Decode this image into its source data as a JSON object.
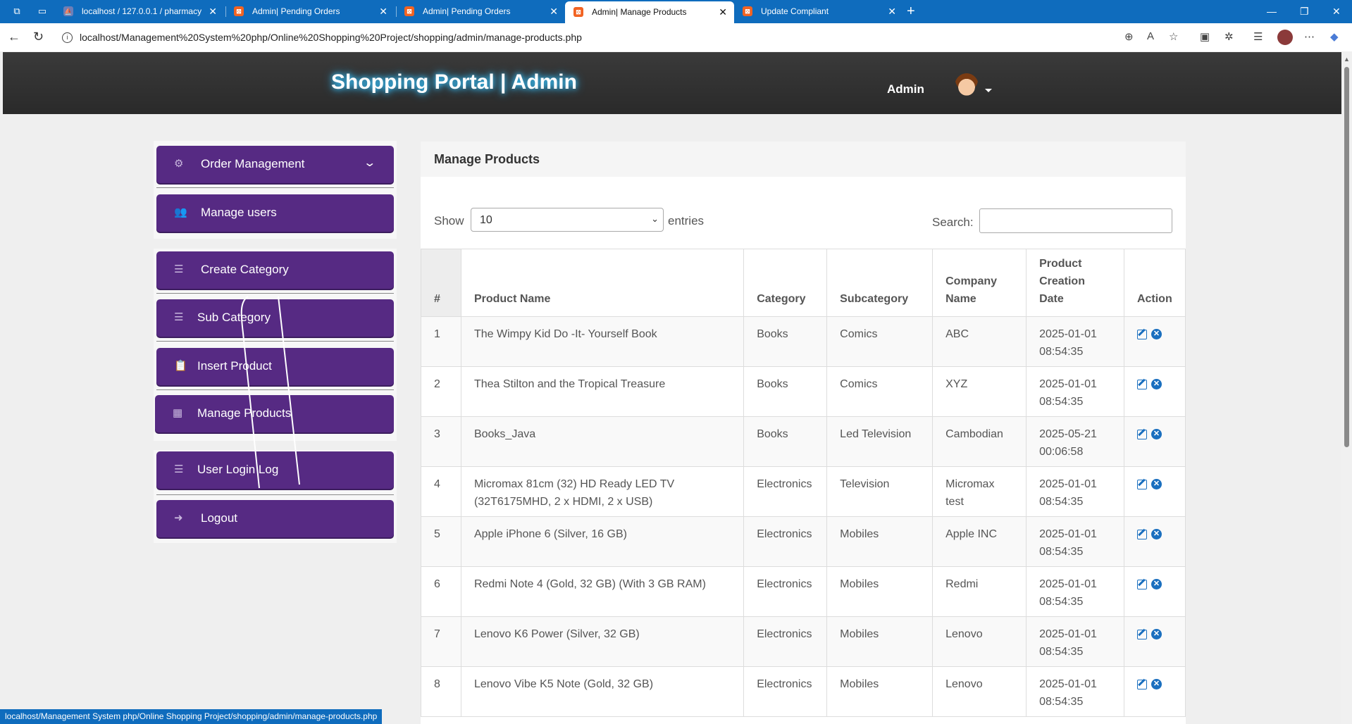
{
  "browser": {
    "tabs": [
      {
        "title": "localhost / 127.0.0.1 / pharmacy",
        "favicon": "phpmyadmin-icon"
      },
      {
        "title": "Admin| Pending Orders",
        "favicon": "xampp-icon"
      },
      {
        "title": "Admin| Pending Orders",
        "favicon": "xampp-icon"
      },
      {
        "title": "Admin| Manage Products",
        "favicon": "xampp-icon",
        "active": true
      },
      {
        "title": "Update Compliant",
        "favicon": "xampp-icon"
      }
    ],
    "url_host": "localhost",
    "url_path": "/Management%20System%20php/Online%20Shopping%20Project/shopping/admin/manage-products.php",
    "status_url": "localhost/Management System php/Online Shopping Project/shopping/admin/manage-products.php",
    "accent": "#0f6cbd"
  },
  "header": {
    "brand": "Shopping Portal | Admin",
    "user": "Admin"
  },
  "sidebar": {
    "accent": "#562a83",
    "items": [
      {
        "label": "Order Management",
        "icon": "gear-icon"
      },
      {
        "label": "Manage users",
        "icon": "users-icon"
      },
      {
        "label": "Create Category",
        "icon": "list-icon"
      },
      {
        "label": "Sub Category",
        "icon": "list-icon"
      },
      {
        "label": "Insert Product",
        "icon": "paste-icon"
      },
      {
        "label": "Manage Products",
        "icon": "table-icon"
      },
      {
        "label": "User Login Log",
        "icon": "list-icon"
      },
      {
        "label": "Logout",
        "icon": "sign-out-icon"
      }
    ]
  },
  "main": {
    "title": "Manage Products",
    "show_label": "Show",
    "page_size": "10",
    "entries_label": "entries",
    "search_label": "Search:",
    "search_value": "",
    "columns": [
      "#",
      "Product Name",
      "Category",
      "Subcategory",
      "Company Name",
      "Product Creation Date",
      "Action"
    ],
    "rows": [
      {
        "n": "1",
        "name": "The Wimpy Kid Do -It- Yourself Book",
        "category": "Books",
        "sub": "Comics",
        "company": "ABC",
        "date": "2025-01-01",
        "time": "08:54:35"
      },
      {
        "n": "2",
        "name": "Thea Stilton and the Tropical Treasure",
        "category": "Books",
        "sub": "Comics",
        "company": "XYZ",
        "date": "2025-01-01",
        "time": "08:54:35"
      },
      {
        "n": "3",
        "name": "Books_Java",
        "category": "Books",
        "sub": "Led Television",
        "company": "Cambodian",
        "date": "2025-05-21",
        "time": "00:06:58"
      },
      {
        "n": "4",
        "name": "Micromax 81cm (32) HD Ready LED TV (32T6175MHD, 2 x HDMI, 2 x USB)",
        "category": "Electronics",
        "sub": "Television",
        "company": "Micromax test",
        "date": "2025-01-01",
        "time": "08:54:35"
      },
      {
        "n": "5",
        "name": "Apple iPhone 6 (Silver, 16 GB)",
        "category": "Electronics",
        "sub": "Mobiles",
        "company": "Apple INC",
        "date": "2025-01-01",
        "time": "08:54:35"
      },
      {
        "n": "6",
        "name": "Redmi Note 4 (Gold, 32 GB) (With 3 GB RAM)",
        "category": "Electronics",
        "sub": "Mobiles",
        "company": "Redmi",
        "date": "2025-01-01",
        "time": "08:54:35"
      },
      {
        "n": "7",
        "name": "Lenovo K6 Power (Silver, 32 GB)",
        "category": "Electronics",
        "sub": "Mobiles",
        "company": "Lenovo",
        "date": "2025-01-01",
        "time": "08:54:35"
      },
      {
        "n": "8",
        "name": "Lenovo Vibe K5 Note (Gold, 32 GB)",
        "category": "Electronics",
        "sub": "Mobiles",
        "company": "Lenovo",
        "date": "2025-01-01",
        "time": "08:54:35"
      }
    ]
  }
}
